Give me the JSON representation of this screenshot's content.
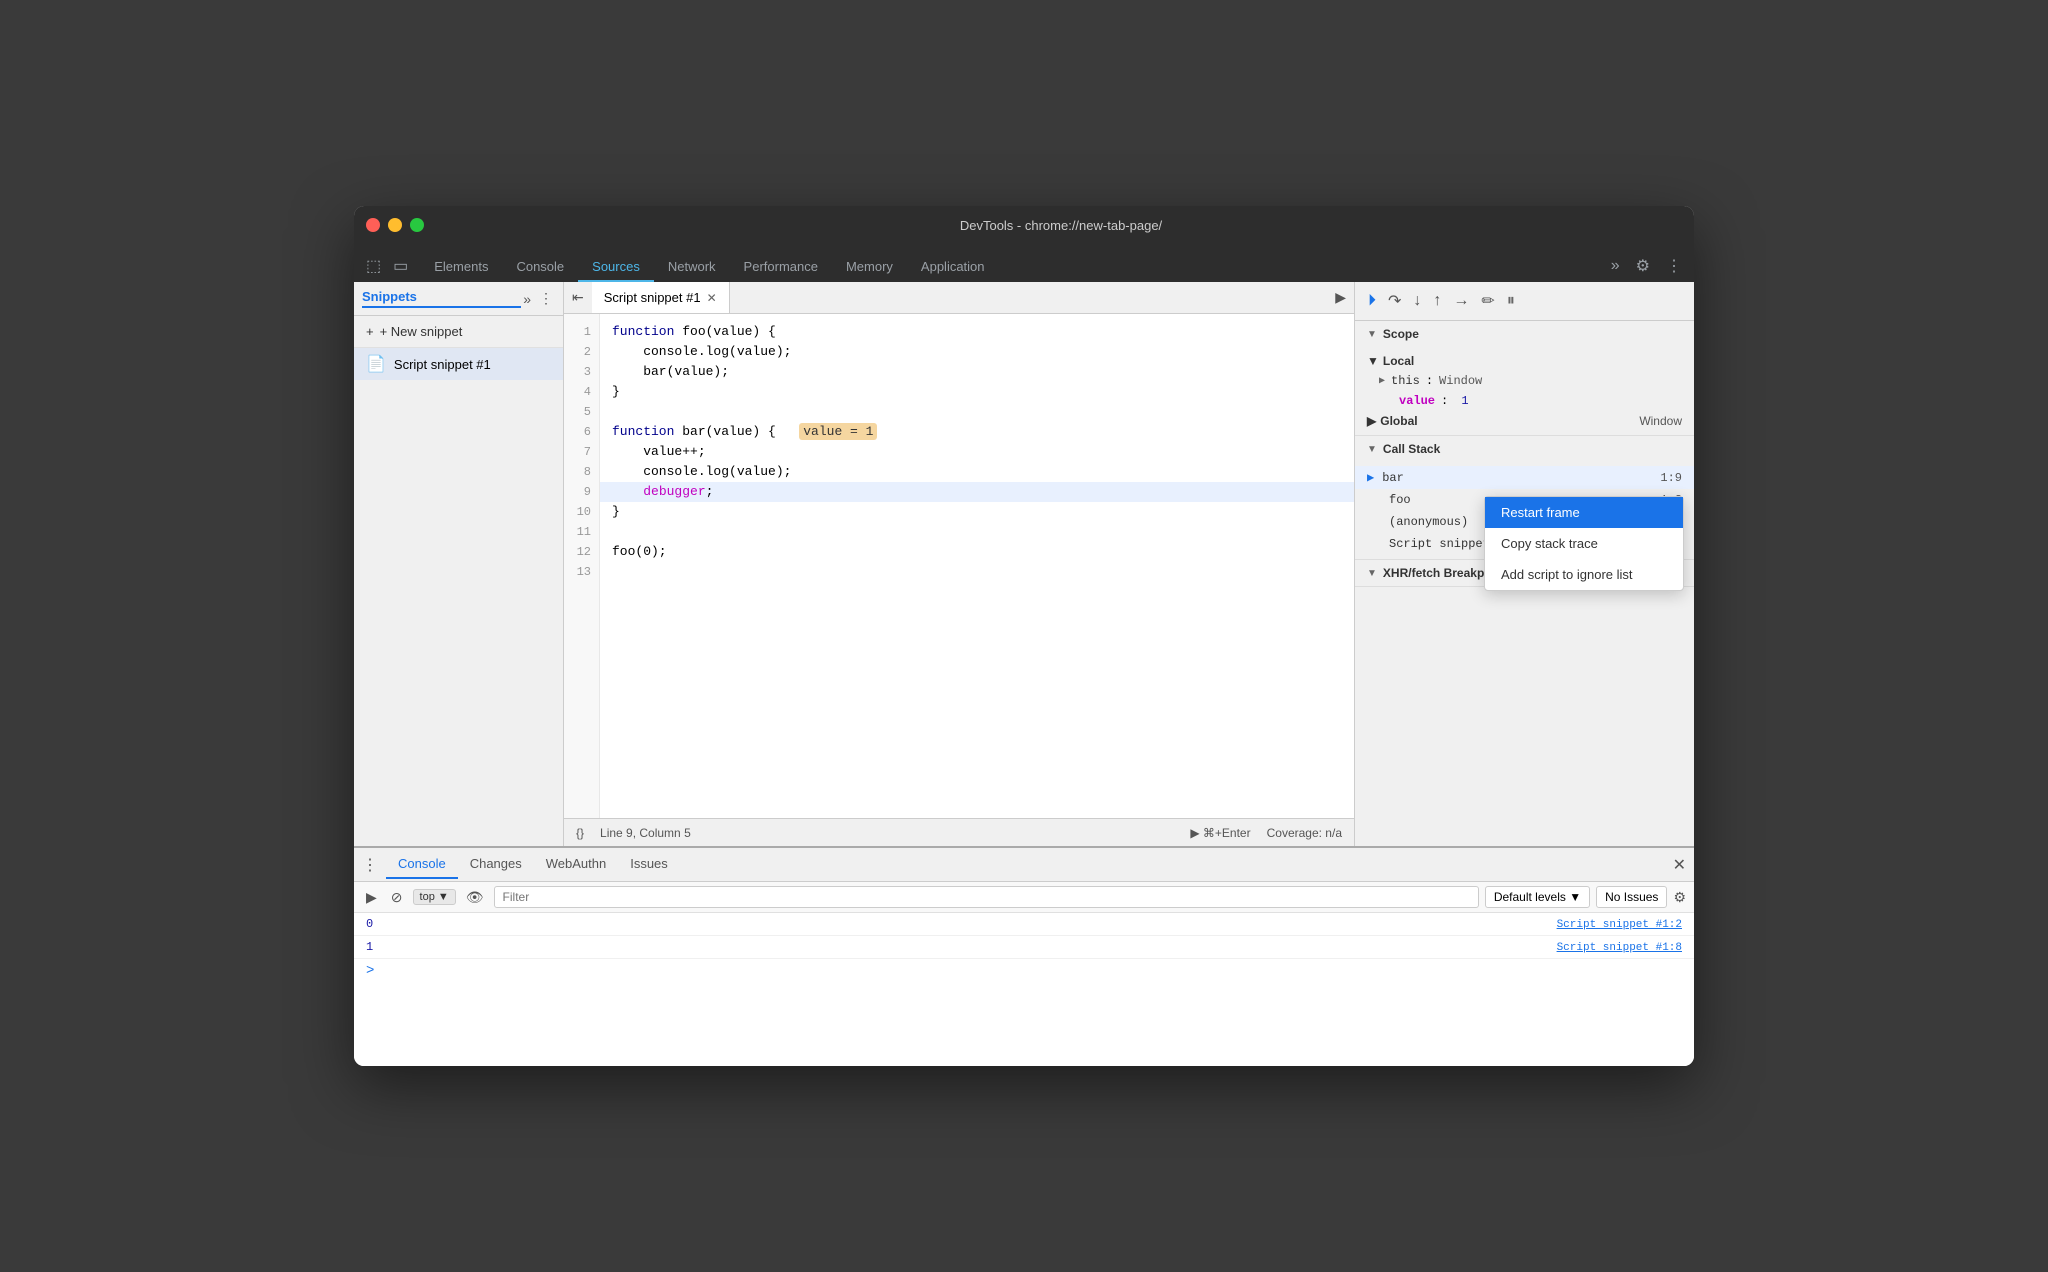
{
  "window": {
    "title": "DevTools - chrome://new-tab-page/"
  },
  "top_tabs": {
    "items": [
      {
        "label": "Elements",
        "active": false
      },
      {
        "label": "Console",
        "active": false
      },
      {
        "label": "Sources",
        "active": true
      },
      {
        "label": "Network",
        "active": false
      },
      {
        "label": "Performance",
        "active": false
      },
      {
        "label": "Memory",
        "active": false
      },
      {
        "label": "Application",
        "active": false
      }
    ]
  },
  "left_panel": {
    "title": "Snippets",
    "new_snippet_label": "+ New snippet",
    "snippet_name": "Script snippet #1"
  },
  "editor": {
    "tab_name": "Script snippet #1",
    "lines": [
      "function foo(value) {",
      "    console.log(value);",
      "    bar(value);",
      "}",
      "",
      "function bar(value) {   value = 1",
      "    value++;",
      "    console.log(value);",
      "    debugger;",
      "}",
      "",
      "foo(0);",
      ""
    ],
    "status": {
      "position": "Line 9, Column 5",
      "run": "⌘+Enter",
      "coverage": "Coverage: n/a"
    }
  },
  "scope": {
    "title": "Scope",
    "local": {
      "title": "Local",
      "items": [
        {
          "key": "this",
          "value": "Window",
          "type": "obj"
        },
        {
          "key": "value",
          "value": "1",
          "type": "number"
        }
      ]
    },
    "global": {
      "title": "Global",
      "value": "Window"
    }
  },
  "call_stack": {
    "title": "Call Stack",
    "items": [
      {
        "name": "bar",
        "location": "1:9",
        "active": true
      },
      {
        "name": "foo",
        "location": "1:3"
      },
      {
        "name": "(anonymous)",
        "location": ""
      },
      {
        "name": "Script snippet #1:12",
        "location": ""
      }
    ]
  },
  "context_menu": {
    "items": [
      {
        "label": "Restart frame",
        "active": true
      },
      {
        "label": "Copy stack trace",
        "active": false
      },
      {
        "label": "Add script to ignore list",
        "active": false
      }
    ]
  },
  "bottom_panel": {
    "tabs": [
      {
        "label": "Console",
        "active": true
      },
      {
        "label": "Changes",
        "active": false
      },
      {
        "label": "WebAuthn",
        "active": false
      },
      {
        "label": "Issues",
        "active": false
      }
    ],
    "toolbar": {
      "top_label": "top",
      "filter_placeholder": "Filter",
      "levels_label": "Default levels ▼",
      "no_issues_label": "No Issues"
    },
    "console_rows": [
      {
        "value": "0",
        "source": "Script snippet #1:2"
      },
      {
        "value": "1",
        "source": "Script snippet #1:8"
      }
    ]
  }
}
